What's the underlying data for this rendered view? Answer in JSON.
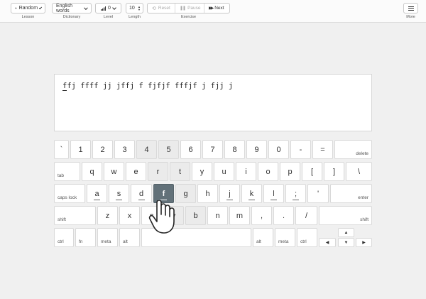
{
  "toolbar": {
    "lesson": {
      "value": "Random",
      "caption": "Lesson",
      "icon": "link-icon"
    },
    "dictionary": {
      "value": "English words",
      "caption": "Dictionary"
    },
    "level": {
      "value": "0",
      "caption": "Level",
      "icon": "signal-bars-icon"
    },
    "length": {
      "value": "10",
      "caption": "Length"
    },
    "exercise": {
      "reset": "Reset",
      "pause": "Pause",
      "next": "Next",
      "caption": "Exercise"
    },
    "more": {
      "caption": "More",
      "icon": "hamburger-menu-icon"
    }
  },
  "exercise_text": {
    "first_char": "f",
    "rest": "fj ffff jj jffj f fjfjf fffjf j fjj j"
  },
  "keyboard": {
    "active_key": "f",
    "row1": [
      {
        "label": "`",
        "shade": false
      },
      {
        "label": "1",
        "shade": false
      },
      {
        "label": "2",
        "shade": false
      },
      {
        "label": "3",
        "shade": false
      },
      {
        "label": "4",
        "shade": true
      },
      {
        "label": "5",
        "shade": true
      },
      {
        "label": "6",
        "shade": false
      },
      {
        "label": "7",
        "shade": false
      },
      {
        "label": "8",
        "shade": false
      },
      {
        "label": "9",
        "shade": false
      },
      {
        "label": "0",
        "shade": false
      },
      {
        "label": "-",
        "shade": false
      },
      {
        "label": "=",
        "shade": false
      },
      {
        "label": "delete",
        "shade": false,
        "mod": "right"
      }
    ],
    "row2": [
      {
        "label": "tab",
        "shade": false,
        "mod": "left"
      },
      {
        "label": "q",
        "shade": false
      },
      {
        "label": "w",
        "shade": false
      },
      {
        "label": "e",
        "shade": false
      },
      {
        "label": "r",
        "shade": true
      },
      {
        "label": "t",
        "shade": true
      },
      {
        "label": "y",
        "shade": false
      },
      {
        "label": "u",
        "shade": false
      },
      {
        "label": "i",
        "shade": false
      },
      {
        "label": "o",
        "shade": false
      },
      {
        "label": "p",
        "shade": false
      },
      {
        "label": "[",
        "shade": false
      },
      {
        "label": "]",
        "shade": false
      },
      {
        "label": "\\",
        "shade": false
      }
    ],
    "row3": [
      {
        "label": "caps lock",
        "shade": false,
        "mod": "left"
      },
      {
        "label": "a",
        "shade": false,
        "home": true
      },
      {
        "label": "s",
        "shade": false,
        "home": true
      },
      {
        "label": "d",
        "shade": false,
        "home": true
      },
      {
        "label": "f",
        "shade": false,
        "home": true,
        "active": true
      },
      {
        "label": "g",
        "shade": true
      },
      {
        "label": "h",
        "shade": false
      },
      {
        "label": "j",
        "shade": false,
        "home": true
      },
      {
        "label": "k",
        "shade": false,
        "home": true
      },
      {
        "label": "l",
        "shade": false,
        "home": true
      },
      {
        "label": ";",
        "shade": false,
        "home": true
      },
      {
        "label": "'",
        "shade": false
      },
      {
        "label": "enter",
        "shade": false,
        "mod": "right"
      }
    ],
    "row4": [
      {
        "label": "shift",
        "shade": false,
        "mod": "left"
      },
      {
        "label": "z",
        "shade": false
      },
      {
        "label": "x",
        "shade": false
      },
      {
        "label": "c",
        "shade": false
      },
      {
        "label": "v",
        "shade": true
      },
      {
        "label": "b",
        "shade": true
      },
      {
        "label": "n",
        "shade": false
      },
      {
        "label": "m",
        "shade": false
      },
      {
        "label": ",",
        "shade": false
      },
      {
        "label": ".",
        "shade": false
      },
      {
        "label": "/",
        "shade": false
      },
      {
        "label": "shift",
        "shade": false,
        "mod": "right"
      }
    ],
    "row5": [
      {
        "label": "ctrl",
        "mod": "left"
      },
      {
        "label": "fn",
        "mod": "left"
      },
      {
        "label": "meta",
        "mod": "left"
      },
      {
        "label": "alt",
        "mod": "left"
      },
      {
        "label": "",
        "space": true
      },
      {
        "label": "alt",
        "mod": "left"
      },
      {
        "label": "meta",
        "mod": "left"
      },
      {
        "label": "ctrl",
        "mod": "left"
      }
    ],
    "arrows": {
      "up": "▲",
      "left": "◀",
      "down": "▼",
      "right": "▶"
    }
  },
  "colors": {
    "active_key": "#627179",
    "shaded_key": "#ebebeb",
    "background": "#f0f0f0"
  }
}
